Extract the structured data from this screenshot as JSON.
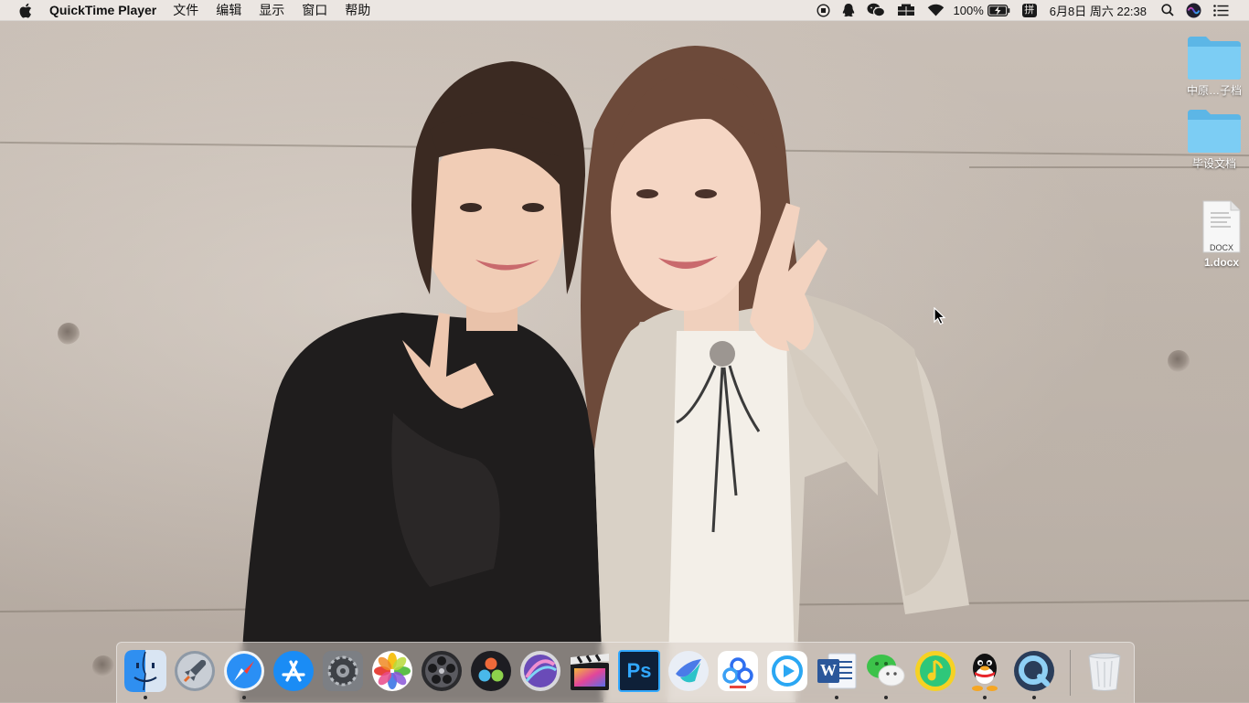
{
  "menubar": {
    "app_name": "QuickTime Player",
    "menus": [
      "文件",
      "编辑",
      "显示",
      "窗口",
      "帮助"
    ],
    "battery": "100%",
    "input_method": "拼",
    "datetime": "6月8日 周六  22:38"
  },
  "desktop": {
    "items": [
      {
        "label": "中原…子档",
        "icon": "folder-icon"
      },
      {
        "label": "毕设文档",
        "icon": "folder-icon"
      },
      {
        "label": "1.docx",
        "icon": "docx-file-icon",
        "badge": "DOCX"
      }
    ]
  },
  "dock": {
    "apps": [
      {
        "name": "Finder",
        "icon": "finder-icon",
        "running": true
      },
      {
        "name": "Launchpad",
        "icon": "launchpad-icon",
        "running": false
      },
      {
        "name": "Safari",
        "icon": "safari-icon",
        "running": true
      },
      {
        "name": "App Store",
        "icon": "app-store-icon",
        "running": false
      },
      {
        "name": "System Preferences",
        "icon": "system-preferences-icon",
        "running": false
      },
      {
        "name": "Photos",
        "icon": "photos-icon",
        "running": false
      },
      {
        "name": "Compressor",
        "icon": "compressor-icon",
        "running": false
      },
      {
        "name": "DaVinci Resolve",
        "icon": "davinci-resolve-icon",
        "running": false
      },
      {
        "name": "Motion",
        "icon": "motion-icon",
        "running": false
      },
      {
        "name": "Final Cut Pro",
        "icon": "final-cut-icon",
        "running": false
      },
      {
        "name": "Photoshop",
        "icon": "photoshop-icon",
        "running": false,
        "text": "Ps"
      },
      {
        "name": "Feishu",
        "icon": "feishu-icon",
        "running": false
      },
      {
        "name": "Baidu Netdisk",
        "icon": "baidu-netdisk-icon",
        "running": false
      },
      {
        "name": "Video Player",
        "icon": "video-player-icon",
        "running": false
      },
      {
        "name": "Microsoft Word",
        "icon": "word-icon",
        "running": true,
        "text": "W"
      },
      {
        "name": "WeChat",
        "icon": "wechat-icon",
        "running": true
      },
      {
        "name": "QQ Music",
        "icon": "qq-music-icon",
        "running": false
      },
      {
        "name": "QQ",
        "icon": "qq-icon",
        "running": true
      },
      {
        "name": "QuickTime Player",
        "icon": "quicktime-icon",
        "running": true
      },
      {
        "name": "Trash",
        "icon": "trash-icon",
        "running": false
      }
    ]
  },
  "colors": {
    "menubar_bg": "#ece8e4",
    "folder": "#6ec3ee",
    "dock_bg": "#d7cdc6",
    "wall": "#c2b8af"
  }
}
